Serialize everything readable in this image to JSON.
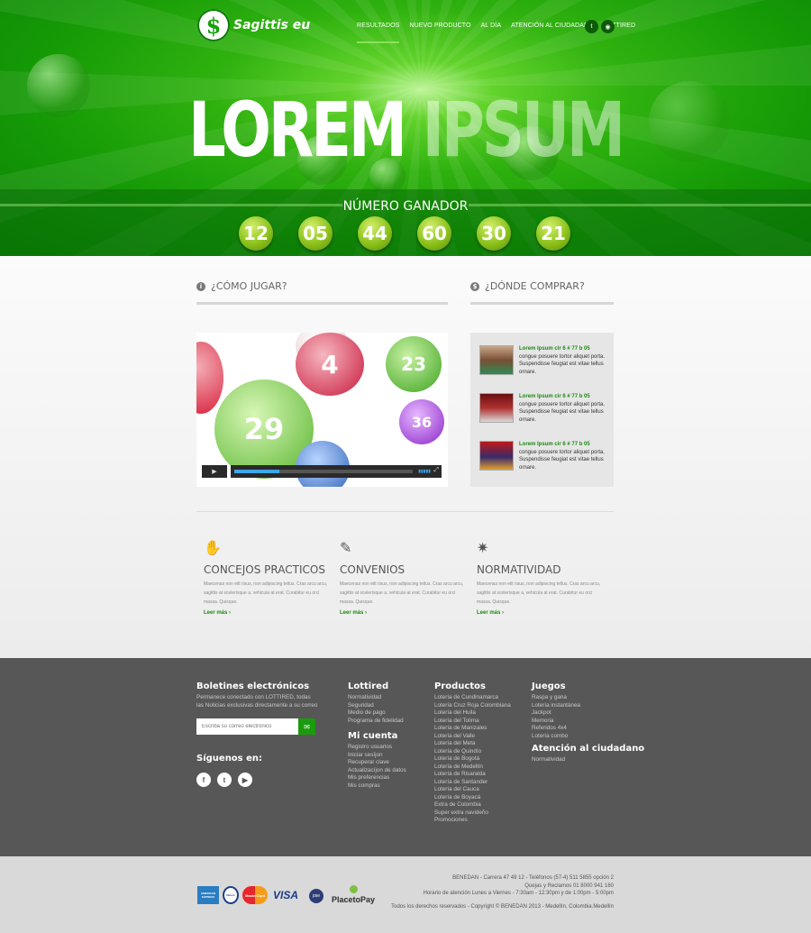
{
  "brand": {
    "logo_text": "Sagittis eu",
    "logo_mark": "$"
  },
  "nav": {
    "items": [
      {
        "label": "RESULTADOS",
        "active": true
      },
      {
        "label": "NUEVO PRODUCTO"
      },
      {
        "label": "AL DÍA"
      },
      {
        "label": "ATENCIÓN AL CIUDADANO"
      },
      {
        "label": "LOTTIRED"
      }
    ],
    "social": [
      "twitter-icon",
      "rss-icon"
    ]
  },
  "hero": {
    "title_a": "LOREM",
    "title_b": "IPSUM",
    "ganador_label": "NÚMERO GANADOR",
    "numbers": [
      "12",
      "05",
      "44",
      "60",
      "30",
      "21"
    ]
  },
  "how_to_play": {
    "title": "¿CÓMO JUGAR?",
    "icon": "info-icon"
  },
  "where_to_buy": {
    "title": "¿DÓNDE COMPRAR?",
    "icon": "dollar-icon",
    "stores": [
      {
        "address": "Lorem Ipsum cir 6 # 77 b 05",
        "text": "congue posuere tortor aliquet porta. Suspendisse feugiat est vitae tellus ornare."
      },
      {
        "address": "Lorem Ipsum cir 6 # 77 b 05",
        "text": "congue posuere tortor aliquet porta. Suspendisse feugiat est vitae tellus ornare."
      },
      {
        "address": "Lorem Ipsum cir 6 # 77 b 05",
        "text": "congue posuere tortor aliquet porta. Suspendisse feugiat est vitae tellus ornare."
      }
    ]
  },
  "video": {
    "balls": [
      "4",
      "23",
      "36",
      "29"
    ],
    "play_icon": "play-icon",
    "fullscreen_icon": "fullscreen-icon"
  },
  "features": [
    {
      "icon": "hand-icon",
      "title": "CONCEJOS PRACTICOS",
      "text": "Maecenas non elit risus, non adipiscing tellus. Cras arcu arcu, sagittis at scelerisque a, vehicula at erat. Curabitur eu orci massa. Quisque.",
      "link": "Leer más ›"
    },
    {
      "icon": "pen-icon",
      "title": "CONVENIOS",
      "text": "Maecenas non elit risus, non adipiscing tellus. Cras arcu arcu, sagittis at scelerisque a, vehicula at erat. Curabitur eu orci massa. Quisque.",
      "link": "Leer más ›"
    },
    {
      "icon": "star-badge-icon",
      "title": "NORMATIVIDAD",
      "text": "Maecenas non elit risus, non adipiscing tellus. Cras arcu arcu, sagittis at scelerisque a, vehicula at erat. Curabitur eu orci massa. Quisque.",
      "link": "Leer más ›"
    }
  ],
  "footer": {
    "newsletter": {
      "title": "Boletines electrónicos",
      "desc": "Permanece conectado con LOTTIRED, todas las Noticias exclusivas directamente a su correo",
      "placeholder": "Escriba su correo electrónico"
    },
    "follow": {
      "title": "Síguenos en:",
      "networks": [
        "facebook-icon",
        "twitter-icon",
        "youtube-icon"
      ]
    },
    "lottired": {
      "title": "Lottired",
      "items": [
        "Normatividad",
        "Seguridad",
        "Medio de pago",
        "Programa de fidelidad"
      ]
    },
    "mi_cuenta": {
      "title": "Mi cuenta",
      "items": [
        "Registro usuarios",
        "Iniciar sesíjon",
        "Recuperar clave",
        "Actualizacíjon de datos",
        "Mis preferencias",
        "Mis compras"
      ]
    },
    "productos": {
      "title": "Productos",
      "items": [
        "Lotería de Cundinamarca",
        "Lotería Cruz Roja Colombiana",
        "Lotería del Huila",
        "Lotería del Tolima",
        "Lotería de Manizales",
        "Lotería del Valle",
        "Lotería del Meta",
        "Lotería de Quindío",
        "Lotería de Bogotá",
        "Lotería de Medellín",
        "Lotería de Risaralda",
        "Lotería de Santander",
        "Lotería del Cauca",
        "Lotería de Boyacá",
        "Extra de Colombia",
        "Super extra navideño",
        "Promociones"
      ]
    },
    "juegos": {
      "title": "Juegos",
      "items": [
        "Raspa y gana",
        "Lotería instantánea",
        "Jackpot",
        "Memoria",
        "Referidos 4x4",
        "Lotería combo"
      ]
    },
    "atencion": {
      "title": "Atención al ciudadano",
      "items": [
        "Normatividad"
      ]
    }
  },
  "bottom": {
    "cards": [
      "AMERICAN EXPRESS",
      "Diners",
      "MasterCard",
      "VISA"
    ],
    "pse": "pse",
    "p2p": "PlacetoPay",
    "legal": [
      "BENEDAN - Carrera 47 49 12 - Teléfonos (57-4) 511 5855 opción 2",
      "Quejas y Reclamos 01 8000 941 160",
      "Horario de atención Lunes a Viernes - 7:30am - 12:30pm y de 1:00pm - 5:00pm",
      "Todos los derechos reservados - Copyright © BENEDAN 2013 - Medellín, Colombia.Medellín"
    ]
  }
}
